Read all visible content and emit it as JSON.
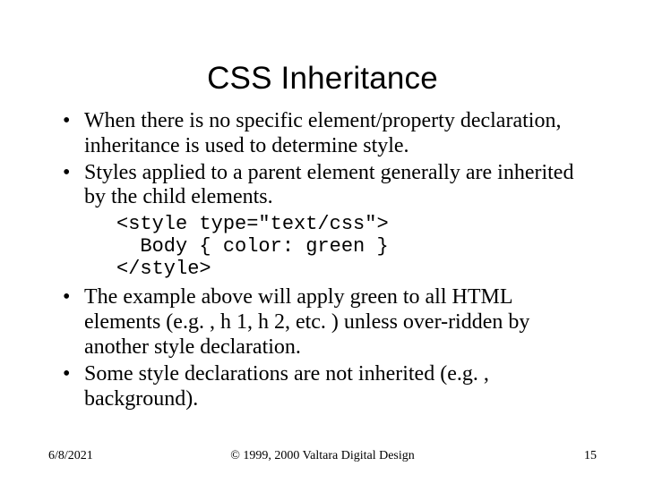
{
  "title": "CSS Inheritance",
  "bullets": {
    "b1": "When there is no specific element/property declaration, inheritance is used to determine style.",
    "b2": "Styles applied to a parent element generally are inherited by the child elements.",
    "b3": "The example above will apply green to all HTML elements (e.g. , h 1, h 2, etc. ) unless over-ridden by another style declaration.",
    "b4": "Some style declarations are not inherited (e.g. , background)."
  },
  "code": "<style type=\"text/css\">\n  Body { color: green }\n</style>",
  "footer": {
    "date": "6/8/2021",
    "copyright": "© 1999, 2000 Valtara Digital Design",
    "page": "15"
  }
}
